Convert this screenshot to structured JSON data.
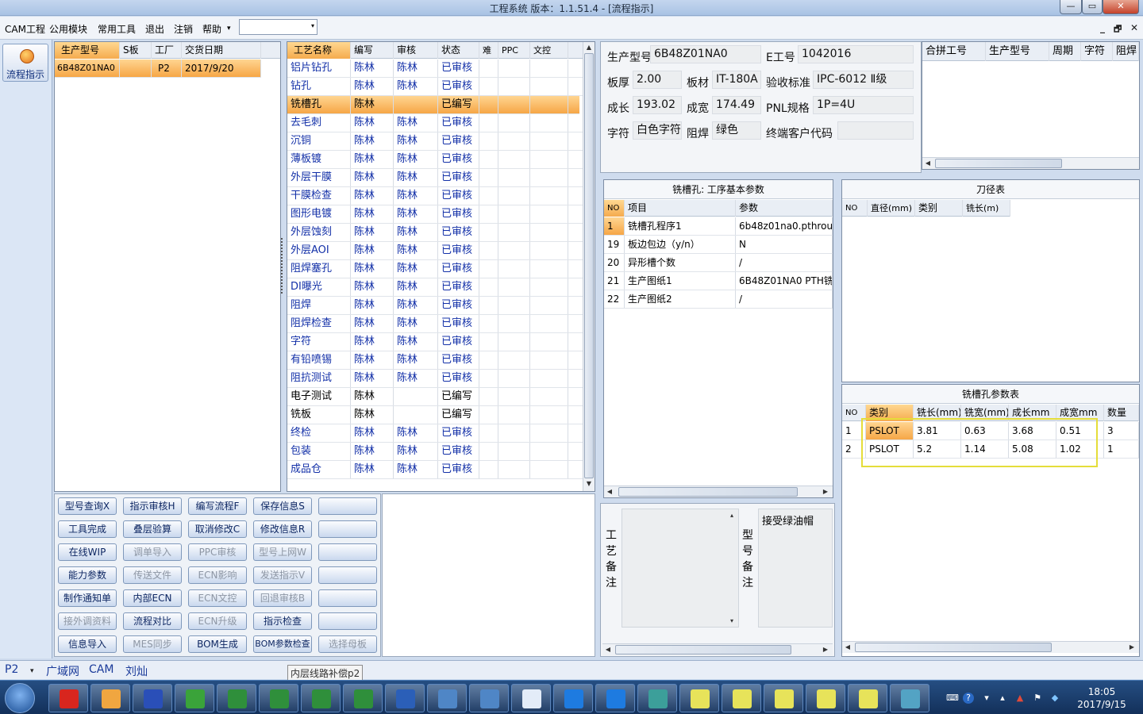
{
  "window": {
    "title": "工程系统   版本：1.1.51.4 - [流程指示]",
    "min": "—",
    "max": "▭",
    "close": "✕"
  },
  "menu": {
    "items": [
      "CAM工程",
      "公用模块",
      "常用工具",
      "退出",
      "注销",
      "帮助"
    ],
    "combo_value": "",
    "mdi_min": "_",
    "mdi_restore": "🗗",
    "mdi_close": "✕"
  },
  "left": {
    "flow_button": "流程指示"
  },
  "order_grid": {
    "columns": [
      "生产型号",
      "S板",
      "工厂",
      "交货日期"
    ],
    "rows": [
      [
        "6B48Z01NA0",
        "",
        "P2",
        "2017/9/20"
      ]
    ]
  },
  "process_grid": {
    "columns": [
      "工艺名称",
      "编写",
      "审核",
      "状态",
      "难",
      "PPC",
      "文控"
    ],
    "rows": [
      [
        "铝片钻孔",
        "陈林",
        "陈林",
        "已审核"
      ],
      [
        "钻孔",
        "陈林",
        "陈林",
        "已审核"
      ],
      [
        "铣槽孔",
        "陈林",
        "",
        "已编写"
      ],
      [
        "去毛刺",
        "陈林",
        "陈林",
        "已审核"
      ],
      [
        "沉铜",
        "陈林",
        "陈林",
        "已审核"
      ],
      [
        "薄板镀",
        "陈林",
        "陈林",
        "已审核"
      ],
      [
        "外层干膜",
        "陈林",
        "陈林",
        "已审核"
      ],
      [
        "干膜检查",
        "陈林",
        "陈林",
        "已审核"
      ],
      [
        "图形电镀",
        "陈林",
        "陈林",
        "已审核"
      ],
      [
        "外层蚀刻",
        "陈林",
        "陈林",
        "已审核"
      ],
      [
        "外层AOI",
        "陈林",
        "陈林",
        "已审核"
      ],
      [
        "阻焊塞孔",
        "陈林",
        "陈林",
        "已审核"
      ],
      [
        "DI曝光",
        "陈林",
        "陈林",
        "已审核"
      ],
      [
        "阻焊",
        "陈林",
        "陈林",
        "已审核"
      ],
      [
        "阻焊检查",
        "陈林",
        "陈林",
        "已审核"
      ],
      [
        "字符",
        "陈林",
        "陈林",
        "已审核"
      ],
      [
        "有铅喷锡",
        "陈林",
        "陈林",
        "已审核"
      ],
      [
        "阻抗测试",
        "陈林",
        "陈林",
        "已审核"
      ],
      [
        "电子测试",
        "陈林",
        "",
        "已编写"
      ],
      [
        "铣板",
        "陈林",
        "",
        "已编写"
      ],
      [
        "终检",
        "陈林",
        "陈林",
        "已审核"
      ],
      [
        "包装",
        "陈林",
        "陈林",
        "已审核"
      ],
      [
        "成品仓",
        "陈林",
        "陈林",
        "已审核"
      ]
    ]
  },
  "actions": [
    [
      "型号查询X",
      "指示审核H",
      "编写流程F",
      "保存信息S",
      ""
    ],
    [
      "工具完成",
      "叠层验算",
      "取消修改C",
      "修改信息R",
      ""
    ],
    [
      "在线WIP",
      "调单导入",
      "PPC审核",
      "型号上网W",
      ""
    ],
    [
      "能力参数",
      "传送文件",
      "ECN影响",
      "发送指示V",
      ""
    ],
    [
      "制作通知单",
      "内部ECN",
      "ECN文控",
      "回退审核B",
      ""
    ],
    [
      "接外调资料",
      "流程对比",
      "ECN升级",
      "指示检查",
      ""
    ],
    [
      "信息导入",
      "MES同步",
      "BOM生成",
      "BOM参数检查",
      "选择母板"
    ]
  ],
  "info": {
    "model_label": "生产型号",
    "model": "6B48Z01NA0",
    "eno_label": "E工号",
    "eno": "1042016",
    "thick_label": "板厚",
    "thick": "2.00",
    "material_label": "板材",
    "material": "IT-180A",
    "std_label": "验收标准",
    "std": "IPC-6012 Ⅱ级",
    "len_label": "成长",
    "len": "193.02",
    "wid_label": "成宽",
    "wid": "174.49",
    "pnl_label": "PNL规格",
    "pnl": "1P=4U",
    "char_label": "字符",
    "char": "白色字符",
    "mask_label": "阻焊",
    "mask": "绿色",
    "cust_label": "终端客户代码",
    "cust": ""
  },
  "merge_grid": {
    "columns": [
      "合拼工号",
      "生产型号",
      "周期",
      "字符",
      "阻焊"
    ]
  },
  "params": {
    "title": "铣槽孔: 工序基本参数",
    "columns": [
      "NO",
      "项目",
      "参数"
    ],
    "rows": [
      [
        "1",
        "铣槽孔程序1",
        "6b48z01na0.pthrou"
      ],
      [
        "19",
        "板边包边（y/n）",
        "N"
      ],
      [
        "20",
        "异形槽个数",
        "/"
      ],
      [
        "21",
        "生产图纸1",
        "6B48Z01NA0 PTH铣..."
      ],
      [
        "22",
        "生产图纸2",
        "/"
      ]
    ]
  },
  "tool_table": {
    "title": "刀径表",
    "columns": [
      "NO",
      "直径(mm)",
      "类别",
      "铣长(m)"
    ]
  },
  "slot_table": {
    "title": "铣槽孔参数表",
    "columns": [
      "NO",
      "类别",
      "铣长(mm)",
      "铣宽(mm)",
      "成长mm",
      "成宽mm",
      "数量"
    ],
    "rows": [
      [
        "1",
        "PSLOT",
        "3.81",
        "0.63",
        "3.68",
        "0.51",
        "3"
      ],
      [
        "2",
        "PSLOT",
        "5.2",
        "1.14",
        "5.08",
        "1.02",
        "1"
      ]
    ]
  },
  "remarks": {
    "process_label": [
      "工",
      "艺",
      "备",
      "注"
    ],
    "model_label": [
      "型",
      "号",
      "备",
      "注"
    ],
    "model_text": "接受绿油帽"
  },
  "statusbar": {
    "factory": "P2",
    "net": "广域网",
    "dept": "CAM",
    "user": "刘灿",
    "tooltip": "内层线路补偿p2"
  },
  "clock": {
    "time": "18:05",
    "date": "2017/9/15"
  },
  "colors": {
    "accent": "#f6a646",
    "highlight_box": "#e5dd3a",
    "link_text": "#1330a8"
  }
}
